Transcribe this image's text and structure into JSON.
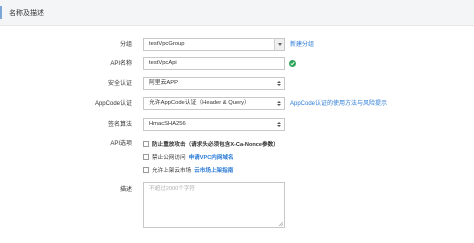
{
  "section": {
    "title": "名称及描述"
  },
  "group": {
    "label": "分组",
    "value": "testVpcGroup",
    "create_link": "新建分组"
  },
  "api_name": {
    "label": "API名称",
    "value": "testVpcApi"
  },
  "security": {
    "label": "安全认证",
    "value": "阿里云APP"
  },
  "appcode": {
    "label": "AppCode认证",
    "value": "允许AppCode认证（Header & Query）",
    "help_link": "AppCode认证的使用方法与风险提示"
  },
  "signature": {
    "label": "签名算法",
    "value": "HmacSHA256"
  },
  "api_options": {
    "label": "API选项",
    "items": [
      {
        "text": "防止重放攻击（请求头必须包含X-Ca-Nonce参数）",
        "checked": false,
        "link": ""
      },
      {
        "text": "禁止公网访问",
        "checked": false,
        "link": "申请VPC内网域名"
      },
      {
        "text": "允许上架云市场",
        "checked": false,
        "link": "云市场上架指南"
      }
    ]
  },
  "description": {
    "label": "描述",
    "placeholder": "不超过2000个字符"
  },
  "colors": {
    "link": "#2b7bd6",
    "success": "#2ea55c",
    "header_bg": "#f4f5f7"
  }
}
